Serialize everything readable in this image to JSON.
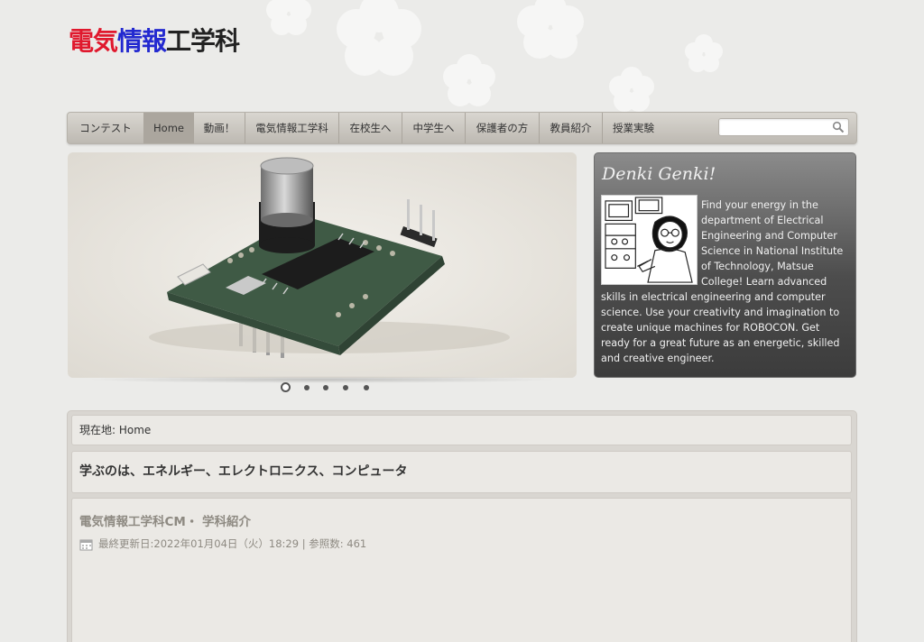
{
  "site": {
    "logo_part1": "電気",
    "logo_part2": "情報",
    "logo_part3": "工学科"
  },
  "nav": {
    "items": [
      {
        "label": "コンテスト"
      },
      {
        "label": "Home"
      },
      {
        "label": "動画！"
      },
      {
        "label": "電気情報工学科"
      },
      {
        "label": "在校生へ"
      },
      {
        "label": "中学生へ"
      },
      {
        "label": "保護者の方"
      },
      {
        "label": "教員紹介"
      },
      {
        "label": "授業実験"
      }
    ],
    "active": "Home",
    "search_placeholder": ""
  },
  "slider": {
    "slide_count": 5,
    "active_slide": 1
  },
  "side": {
    "title": "Denki Genki!",
    "text": "Find your energy in the department of Electrical Engineering and Computer Science in National Institute of Technology, Matsue College! Learn advanced skills in electrical engineering and computer science. Use your creativity and imagination to create unique machines for ROBOCON. Get ready for a great future as an energetic, skilled and creative engineer."
  },
  "breadcrumb": {
    "prefix": "現在地: ",
    "current": "Home"
  },
  "main": {
    "heading": "学ぶのは、エネルギー、エレクトロニクス、コンピュータ",
    "article_title": "電気情報工学科CM・ 学科紹介",
    "article_meta": "最終更新日:2022年01月04日（火）18:29 | 参照数: 461"
  },
  "colors": {
    "logo_red": "#e0182d",
    "logo_blue": "#2329d0",
    "nav_active": "#aba69e",
    "panel_dark": "#3c3c3c",
    "meta_text": "#8e8a82"
  }
}
